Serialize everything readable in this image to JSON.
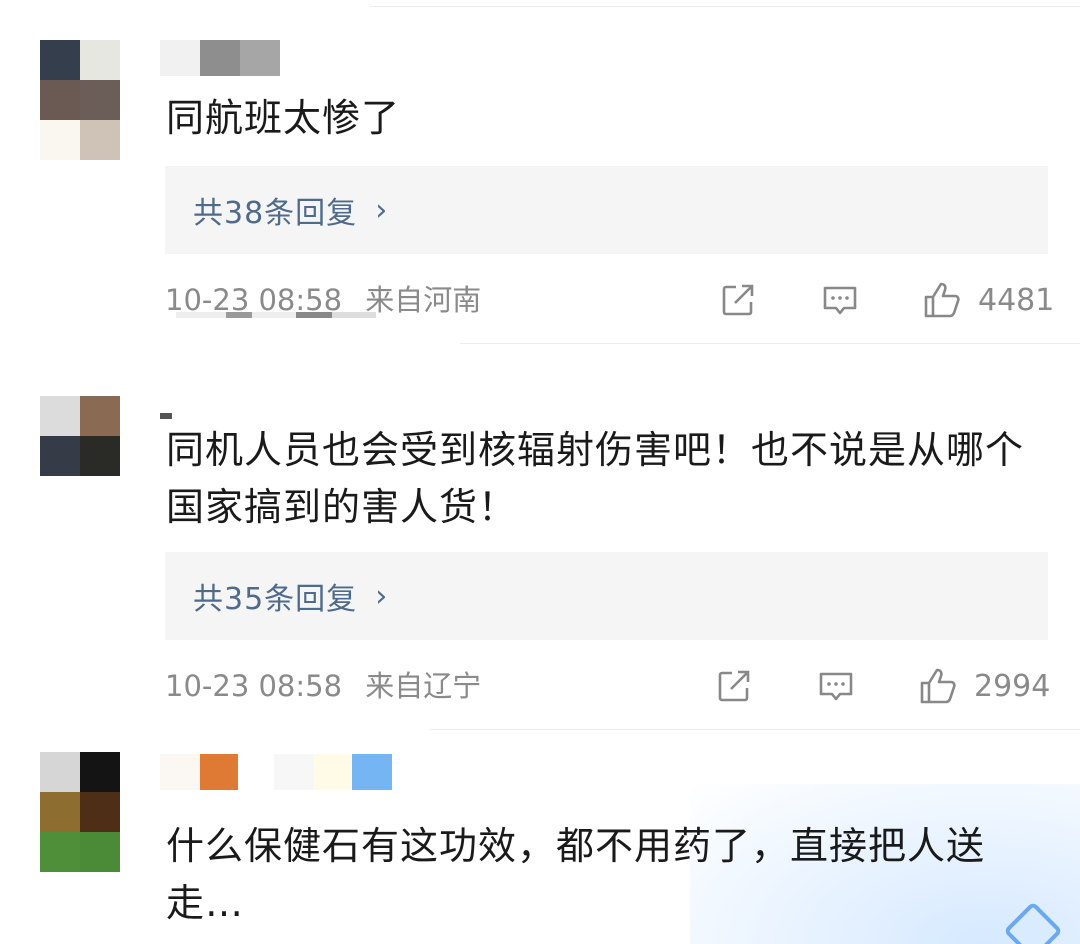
{
  "comments": [
    {
      "text": "同航班太惨了",
      "reply": {
        "label": "共38条回复",
        "chevron": "›"
      },
      "time": "10-23 08:58",
      "location": "来自河南",
      "likes": "4481"
    },
    {
      "text": "同机人员也会受到核辐射伤害吧！也不说是从哪个国家搞到的害人货！",
      "reply": {
        "label": "共35条回复",
        "chevron": "›"
      },
      "time": "10-23 08:58",
      "location": "来自辽宁",
      "likes": "2994"
    },
    {
      "text": "什么保健石有这功效，都不用药了，直接把人送走…"
    }
  ],
  "icons": {
    "share": "share-icon",
    "comment": "comment-icon",
    "like": "thumbs-up-icon"
  },
  "colors": {
    "reply_link": "#4e6a8d",
    "meta_text": "#8a8a8a",
    "reply_bg": "#f5f5f5"
  }
}
